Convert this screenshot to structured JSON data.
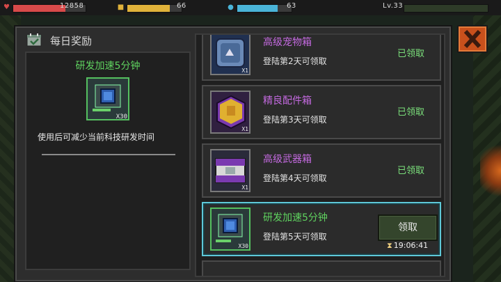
{
  "topbar": {
    "hp_value": "12858",
    "energy_value": "66",
    "water_value": "63",
    "level_value": "Lv.33",
    "hp_fill": 0.72,
    "energy_fill": 0.78,
    "water_fill": 0.74,
    "level_fill": 0.0
  },
  "colors": {
    "hp": "#d84a4a",
    "energy": "#e0b23a",
    "water": "#4ab4d8",
    "level": "#5a8a4a",
    "green_text": "#5fd35f",
    "purple_text": "#c46ae0",
    "active_border": "#5ec8d8",
    "close": "#c8501c"
  },
  "panel": {
    "title": "每日奖励",
    "title_icon": "calendar-check-icon"
  },
  "detail": {
    "name": "研发加速5分钟",
    "icon": "research-speedup-chip-icon",
    "quantity": "X30",
    "description": "使用后可减少当前科技研发时间"
  },
  "rewards": [
    {
      "name": "高级宠物箱",
      "day_text": "登陆第2天可领取",
      "status": "已领取",
      "icon": "pet-crate-icon",
      "qty": "X1",
      "name_color": "#c46ae0"
    },
    {
      "name": "精良配件箱",
      "day_text": "登陆第3天可领取",
      "status": "已领取",
      "icon": "parts-crate-icon",
      "qty": "X1",
      "name_color": "#c46ae0"
    },
    {
      "name": "高级武器箱",
      "day_text": "登陆第4天可领取",
      "status": "已领取",
      "icon": "weapon-crate-icon",
      "qty": "X1",
      "name_color": "#c46ae0"
    },
    {
      "name": "研发加速5分钟",
      "day_text": "登陆第5天可领取",
      "button": "领取",
      "timer": "19:06:41",
      "icon": "research-speedup-chip-icon",
      "qty": "X30",
      "name_color": "#5fd35f"
    }
  ],
  "close_icon": "close-x-icon"
}
